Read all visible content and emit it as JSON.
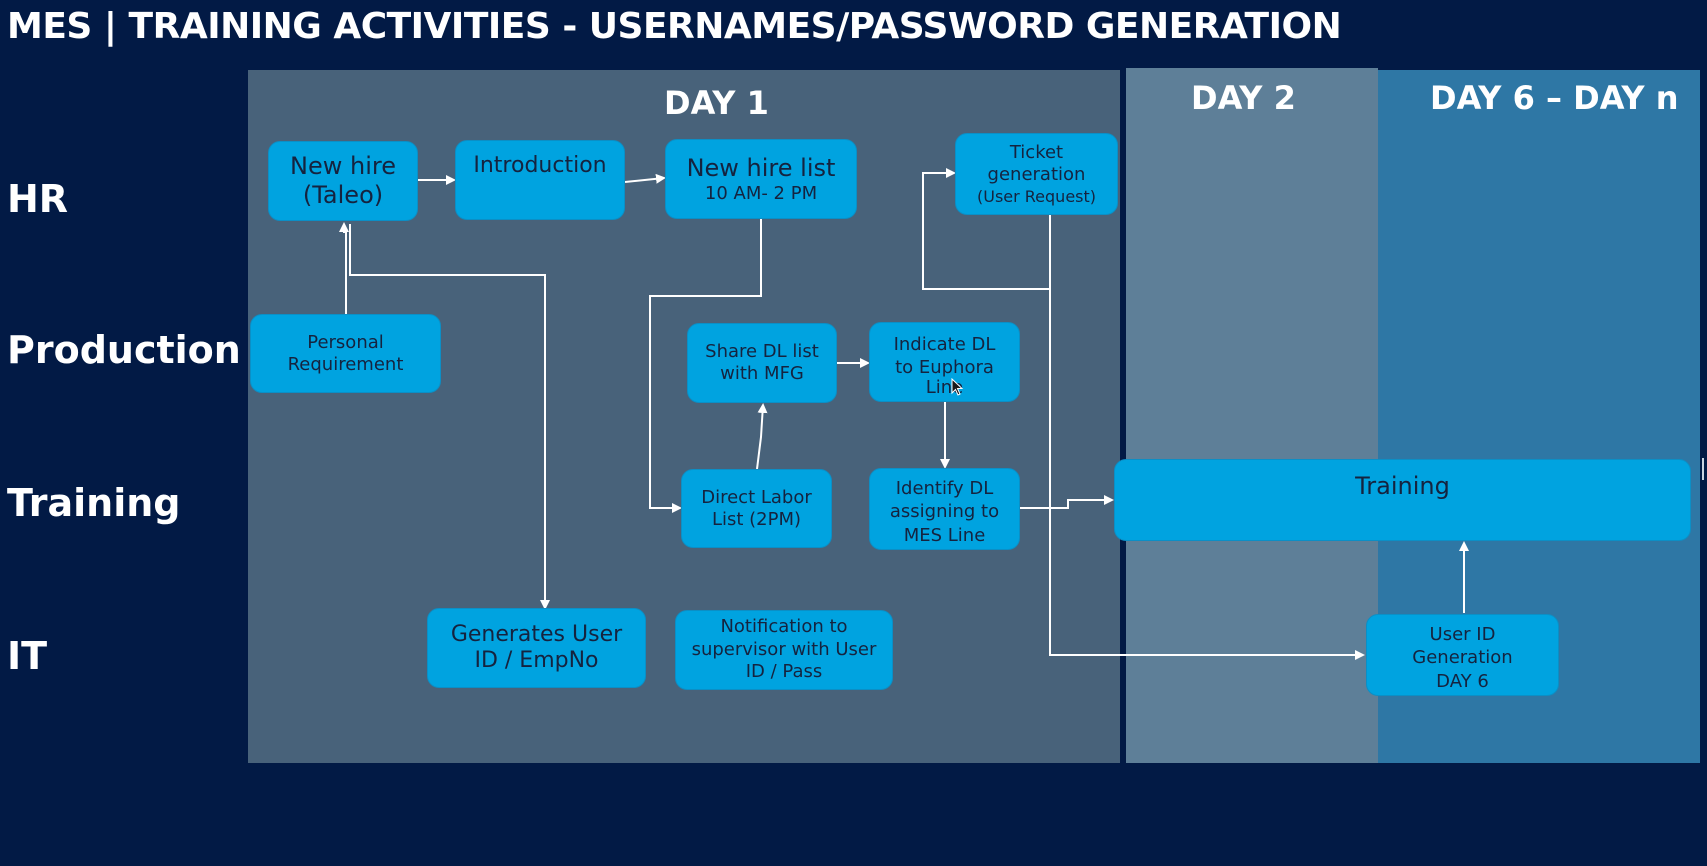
{
  "title": "MES | TRAINING ACTIVITIES - USERNAMES/PASSWORD GENERATION",
  "columns": [
    {
      "id": "day1",
      "label": "DAY 1"
    },
    {
      "id": "day2",
      "label": "DAY 2"
    },
    {
      "id": "day6",
      "label": "DAY 6 – DAY n"
    }
  ],
  "lanes": [
    "HR",
    "Production",
    "Training",
    "IT"
  ],
  "boxes": {
    "new_hire": {
      "line1": "New hire",
      "line2": "(Taleo)"
    },
    "introduction": {
      "line1": "Introduction"
    },
    "new_hire_list": {
      "line1": "New hire list",
      "line2": "10 AM- 2 PM"
    },
    "ticket": {
      "line1": "Ticket",
      "line2": "generation",
      "line3": "(User Request)"
    },
    "personal_req": {
      "line1": "Personal",
      "line2": "Requirement"
    },
    "share_dl": {
      "line1": "Share DL list",
      "line2": "with MFG"
    },
    "indicate_dl": {
      "line1": "Indicate DL",
      "line2": "to Euphora",
      "line3": "Line"
    },
    "direct_labor": {
      "line1": "Direct Labor",
      "line2": "List (2PM)"
    },
    "identify_dl": {
      "line1": "Identify DL",
      "line2": "assigning to",
      "line3": "MES Line"
    },
    "training": {
      "line1": "Training"
    },
    "generates_user": {
      "line1": "Generates User",
      "line2": "ID / EmpNo"
    },
    "notification": {
      "line1": "Notification to",
      "line2": "supervisor with User",
      "line3": "ID / Pass"
    },
    "user_id_gen": {
      "line1": "User ID",
      "line2": "Generation",
      "line3": "DAY 6"
    }
  },
  "colors": {
    "background": "#021a45",
    "day1_panel": "#48627a",
    "day2_panel": "#5e7f98",
    "day6_panel": "#2e77a5",
    "box_fill": "#00a3e0",
    "box_text": "#15233f",
    "connector": "#ffffff"
  }
}
